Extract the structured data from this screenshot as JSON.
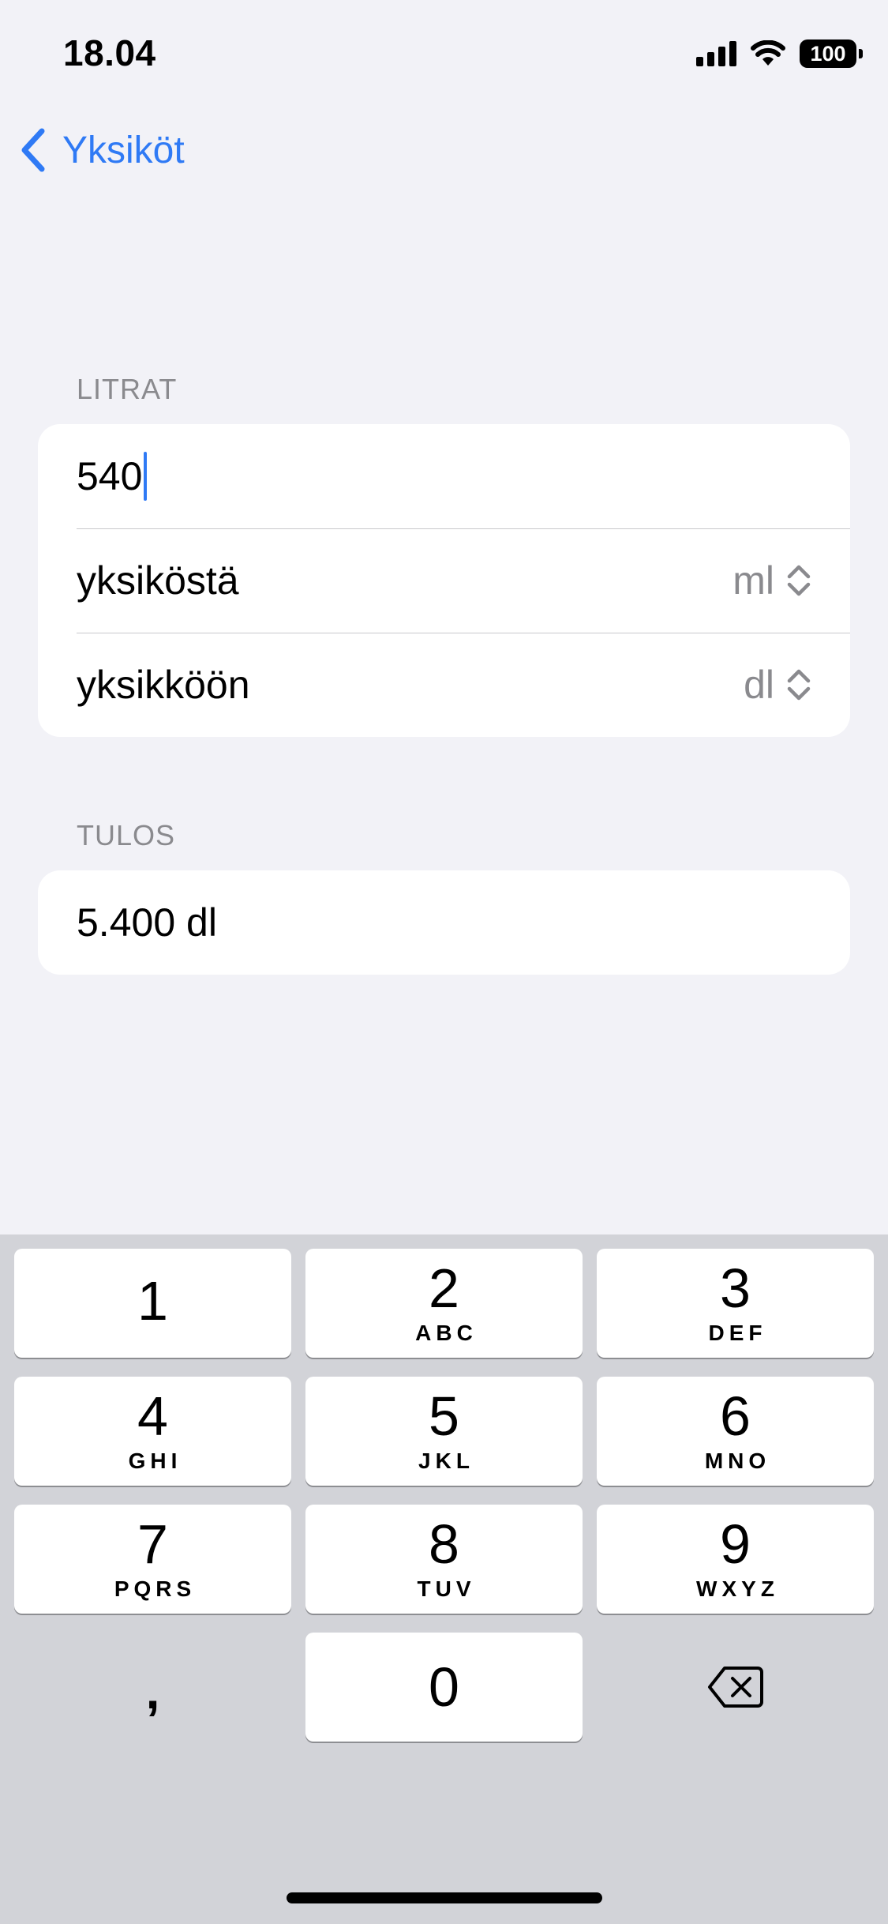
{
  "status_bar": {
    "time": "18.04",
    "battery": "100"
  },
  "nav": {
    "back_label": "Yksiköt"
  },
  "input_section": {
    "header": "LITRAT",
    "value_input": "540",
    "from_label": "yksiköstä",
    "from_value": "ml",
    "to_label": "yksikköön",
    "to_value": "dl"
  },
  "result_section": {
    "header": "TULOS",
    "value": "5.400 dl"
  },
  "keyboard": {
    "keys": [
      {
        "digit": "1",
        "letters": ""
      },
      {
        "digit": "2",
        "letters": "ABC"
      },
      {
        "digit": "3",
        "letters": "DEF"
      },
      {
        "digit": "4",
        "letters": "GHI"
      },
      {
        "digit": "5",
        "letters": "JKL"
      },
      {
        "digit": "6",
        "letters": "MNO"
      },
      {
        "digit": "7",
        "letters": "PQRS"
      },
      {
        "digit": "8",
        "letters": "TUV"
      },
      {
        "digit": "9",
        "letters": "WXYZ"
      },
      {
        "digit": "0",
        "letters": ""
      }
    ],
    "comma": ","
  },
  "colors": {
    "accent": "#2f7af5",
    "background": "#f2f2f7",
    "keyboard_background": "#d2d3d8",
    "secondary_text": "#8a8a8e"
  },
  "icons": {
    "back": "chevron-left-icon",
    "picker": "chevron-up-down-icon",
    "delete": "backspace-icon",
    "signal": "cellular-signal-icon",
    "wifi": "wifi-icon",
    "battery": "battery-icon"
  }
}
